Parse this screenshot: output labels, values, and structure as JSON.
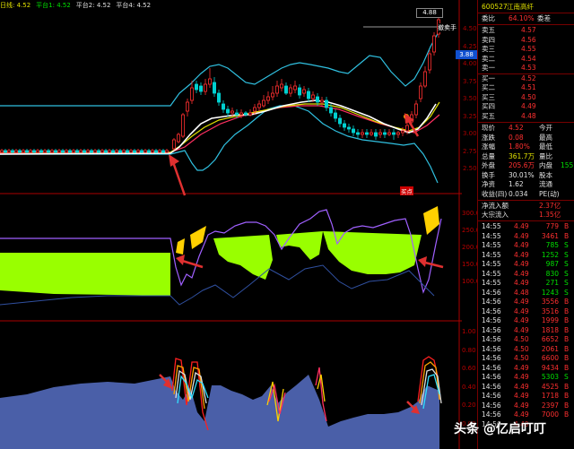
{
  "header": {
    "items": [
      {
        "label": "日线:",
        "value": "4.52",
        "color": "#e0e000"
      },
      {
        "label": "平台1:",
        "value": "4.52",
        "color": "#00e000"
      },
      {
        "label": "平台2:",
        "value": "4.52",
        "color": "#e0e0e0"
      },
      {
        "label": "平台4:",
        "value": "4.52",
        "color": "#e0e0e0"
      }
    ]
  },
  "cursor_value": "4.88",
  "sell_tag": "撤卖手",
  "signal_tag": "买点",
  "last_price_tag": "3.88",
  "price_axis": [
    "4.50",
    "4.25",
    "4.00",
    "3.75",
    "3.50",
    "3.25",
    "3.00",
    "2.75",
    "2.50"
  ],
  "indicator1_axis": [
    "300.00",
    "250.00",
    "200.00",
    "150.00",
    "100.00"
  ],
  "indicator2_axis": [
    "1.00",
    "0.80",
    "0.60",
    "0.40",
    "0.20",
    "0.00"
  ],
  "stock": {
    "code": "600527",
    "name": "江南高纤"
  },
  "order_book": {
    "ratio_label": "委比",
    "ratio_value": "64.10%",
    "diff_label": "委差",
    "diff_value": "",
    "asks": [
      {
        "label": "卖五",
        "price": "4.57",
        "vol": ""
      },
      {
        "label": "卖四",
        "price": "4.56",
        "vol": ""
      },
      {
        "label": "卖三",
        "price": "4.55",
        "vol": ""
      },
      {
        "label": "卖二",
        "price": "4.54",
        "vol": ""
      },
      {
        "label": "卖一",
        "price": "4.53",
        "vol": ""
      }
    ],
    "bids": [
      {
        "label": "买一",
        "price": "4.52",
        "vol": ""
      },
      {
        "label": "买二",
        "price": "4.51",
        "vol": ""
      },
      {
        "label": "买三",
        "price": "4.50",
        "vol": ""
      },
      {
        "label": "买四",
        "price": "4.49",
        "vol": ""
      },
      {
        "label": "买五",
        "price": "4.48",
        "vol": ""
      }
    ]
  },
  "quote": [
    {
      "l1": "现价",
      "v1": "4.52",
      "c1": "red",
      "l2": "今开",
      "v2": ""
    },
    {
      "l1": "涨跌",
      "v1": "0.08",
      "c1": "red",
      "l2": "最高",
      "v2": ""
    },
    {
      "l1": "涨幅",
      "v1": "1.80%",
      "c1": "red",
      "l2": "最低",
      "v2": ""
    },
    {
      "l1": "总量",
      "v1": "361.7万",
      "c1": "yel",
      "l2": "量比",
      "v2": ""
    },
    {
      "l1": "外盘",
      "v1": "205.6万",
      "c1": "red",
      "l2": "内盘",
      "v2": "155"
    },
    {
      "l1": "换手",
      "v1": "30.01%",
      "c1": "wht",
      "l2": "股本",
      "v2": ""
    },
    {
      "l1": "净资",
      "v1": "1.62",
      "c1": "wht",
      "l2": "流通",
      "v2": ""
    },
    {
      "l1": "收益(四)",
      "v1": "0.034",
      "c1": "wht",
      "l2": "PE(动)",
      "v2": ""
    }
  ],
  "flows": [
    {
      "label": "净流入额",
      "value": "2.37亿"
    },
    {
      "label": "大宗流入",
      "value": "1.35亿"
    }
  ],
  "ticks": [
    {
      "t": "14:55",
      "p": "4.49",
      "v": "779",
      "s": "B"
    },
    {
      "t": "14:55",
      "p": "4.49",
      "v": "3461",
      "s": "B"
    },
    {
      "t": "14:55",
      "p": "4.49",
      "v": "785",
      "s": "S"
    },
    {
      "t": "14:55",
      "p": "4.49",
      "v": "1252",
      "s": "S"
    },
    {
      "t": "14:55",
      "p": "4.49",
      "v": "987",
      "s": "S"
    },
    {
      "t": "14:55",
      "p": "4.49",
      "v": "830",
      "s": "S"
    },
    {
      "t": "14:55",
      "p": "4.49",
      "v": "271",
      "s": "S"
    },
    {
      "t": "14:56",
      "p": "4.48",
      "v": "1243",
      "s": "S"
    },
    {
      "t": "14:56",
      "p": "4.49",
      "v": "3556",
      "s": "B"
    },
    {
      "t": "14:56",
      "p": "4.49",
      "v": "3516",
      "s": "B"
    },
    {
      "t": "14:56",
      "p": "4.49",
      "v": "1999",
      "s": "B"
    },
    {
      "t": "14:56",
      "p": "4.49",
      "v": "1818",
      "s": "B"
    },
    {
      "t": "14:56",
      "p": "4.50",
      "v": "6652",
      "s": "B"
    },
    {
      "t": "14:56",
      "p": "4.50",
      "v": "2061",
      "s": "B"
    },
    {
      "t": "14:56",
      "p": "4.50",
      "v": "6600",
      "s": "B"
    },
    {
      "t": "14:56",
      "p": "4.49",
      "v": "9434",
      "s": "B"
    },
    {
      "t": "14:56",
      "p": "4.49",
      "v": "5303",
      "s": "S"
    },
    {
      "t": "14:56",
      "p": "4.49",
      "v": "4525",
      "s": "B"
    },
    {
      "t": "14:56",
      "p": "4.49",
      "v": "1718",
      "s": "B"
    },
    {
      "t": "14:56",
      "p": "4.49",
      "v": "2397",
      "s": "B"
    },
    {
      "t": "14:56",
      "p": "4.49",
      "v": "7000",
      "s": "B"
    },
    {
      "t": "14:56",
      "p": "4.49",
      "v": "",
      "s": ""
    }
  ],
  "watermark": "头条 @亿启叮叮",
  "colors": {
    "up": "#ff3030",
    "down": "#00d0d0",
    "ma5": "#ffffff",
    "ma10": "#e0e000",
    "ma20": "#ff3060",
    "band": "#30c0e0",
    "fill_green": "#99ff00",
    "fill_yellow": "#ffd000",
    "fill_blue": "#4a5fa8",
    "purple": "#a060ff"
  }
}
